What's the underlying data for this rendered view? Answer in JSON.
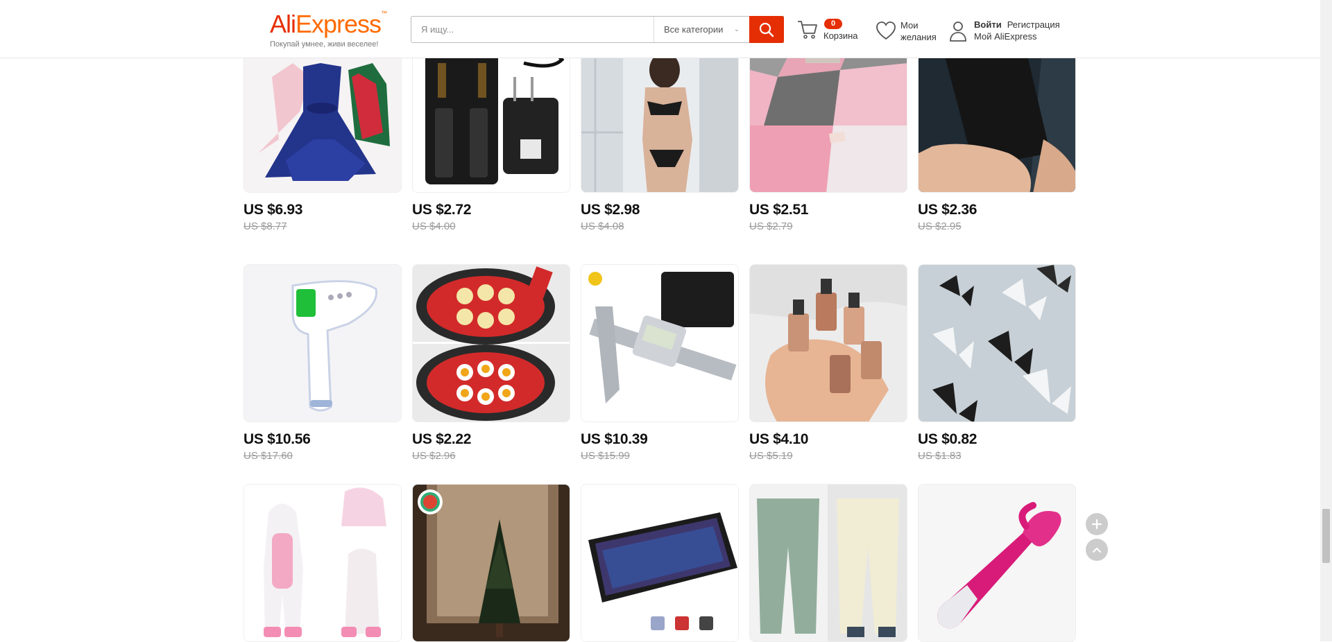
{
  "header": {
    "logo_ali": "Ali",
    "logo_express": "Express",
    "logo_tm": "™",
    "tagline": "Покупай умнее, живи веселее!",
    "search_placeholder": "Я ищу...",
    "category": "Все категории",
    "cart_count": "0",
    "cart_label": "Корзина",
    "wishlist_line1": "Мои",
    "wishlist_line2": "желания",
    "login": "Войти",
    "register": "Регистрация",
    "my_ali": "Мой AliExpress"
  },
  "products": [
    {
      "price": "US $6.93",
      "old_price": "US $8.77",
      "icon": "kids-dress-image"
    },
    {
      "price": "US $2.72",
      "old_price": "US $4.00",
      "icon": "battery-charger-image"
    },
    {
      "price": "US $2.98",
      "old_price": "US $4.08",
      "icon": "lingerie-image"
    },
    {
      "price": "US $2.51",
      "old_price": "US $2.79",
      "icon": "rug-image"
    },
    {
      "price": "US $2.36",
      "old_price": "US $2.95",
      "icon": "phone-case-image"
    },
    {
      "price": "US $10.56",
      "old_price": "US $17.60",
      "icon": "thermometer-image"
    },
    {
      "price": "US $2.22",
      "old_price": "US $2.96",
      "icon": "pancake-mold-image"
    },
    {
      "price": "US $10.39",
      "old_price": "US $15.99",
      "icon": "caliper-image"
    },
    {
      "price": "US $4.10",
      "old_price": "US $5.19",
      "icon": "highlighter-image"
    },
    {
      "price": "US $0.82",
      "old_price": "US $1.83",
      "icon": "butterfly-stickers-image"
    },
    {
      "icon": "unicorn-pajama-image"
    },
    {
      "icon": "curtain-lights-image"
    },
    {
      "icon": "mechanical-keyboard-image"
    },
    {
      "icon": "fleece-pants-image"
    },
    {
      "icon": "pink-massager-image"
    }
  ],
  "colors": {
    "accent": "#e62e04",
    "logo_orange": "#ff6a00"
  }
}
